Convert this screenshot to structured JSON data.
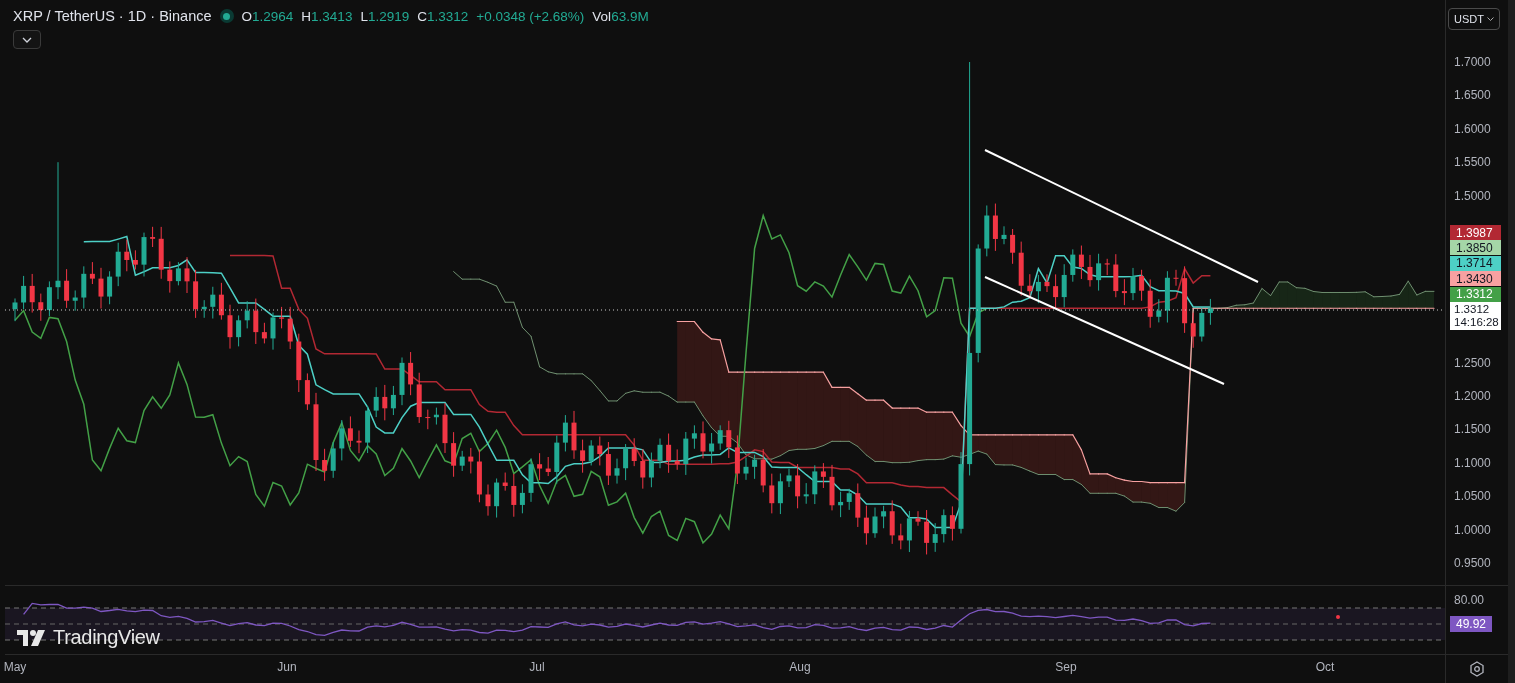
{
  "header": {
    "symbol": "XRP / TetherUS · 1D · Binance",
    "ohlc": [
      {
        "label": "O",
        "value": "1.2964"
      },
      {
        "label": "H",
        "value": "1.3413"
      },
      {
        "label": "L",
        "value": "1.2919"
      },
      {
        "label": "C",
        "value": "1.3312"
      }
    ],
    "change": "+0.0348 (+2.68%)",
    "volume": {
      "label": "Vol",
      "value": "63.9M"
    }
  },
  "currency_dropdown": {
    "value": "USDT"
  },
  "price_axis": {
    "ticks": [
      "1.7000",
      "1.6500",
      "1.6000",
      "1.5500",
      "1.5000",
      "1.2500",
      "1.2000",
      "1.1500",
      "1.1000",
      "1.0500",
      "1.0000",
      "0.9500"
    ]
  },
  "price_badges": [
    {
      "value": "1.3987",
      "color": "#b22833"
    },
    {
      "value": "1.3850",
      "color": "#a5d6a7"
    },
    {
      "value": "1.3714",
      "color": "#4dd0c6"
    },
    {
      "value": "1.3430",
      "color": "#f7a1a1"
    },
    {
      "value": "1.3312",
      "color": "#43a047"
    }
  ],
  "last_price": {
    "value": "1.3312",
    "countdown": "14:16:28"
  },
  "rsi": {
    "axis_label": "80.00",
    "value": "49.92"
  },
  "logo": {
    "text": "TradingView"
  },
  "time_axis": [
    "May",
    "Jun",
    "Jul",
    "Aug",
    "Sep",
    "Oct"
  ]
}
